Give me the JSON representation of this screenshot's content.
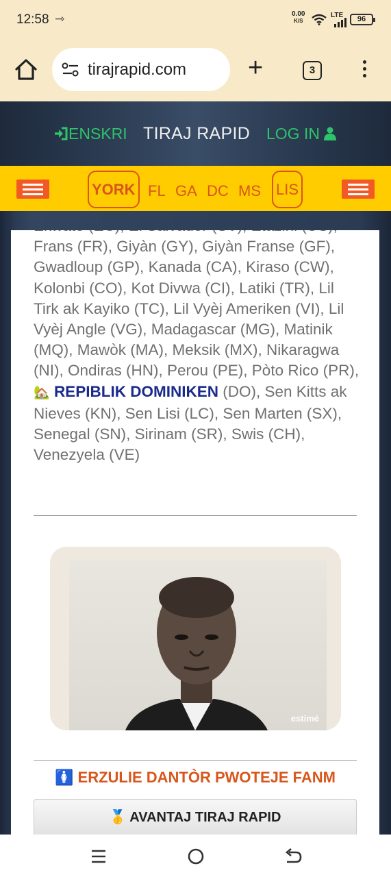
{
  "status": {
    "time": "12:58",
    "net_speed_value": "0.00",
    "net_speed_unit": "K/S",
    "lte": "LTE",
    "battery": "96"
  },
  "browser": {
    "url": "tirajrapid.com",
    "tab_count": "3"
  },
  "header": {
    "register_label": "ENSKRI",
    "title": "TIRAJ RAPID",
    "login_label": "LOG IN"
  },
  "nav": {
    "items": [
      "YORK",
      "FL",
      "GA",
      "DC",
      "MS",
      "LIS"
    ],
    "active": "YORK"
  },
  "countries": {
    "text_before": "Ekwatè (EC), El Salvador (SV), Etazini (US), Frans (FR), Giyàn (GY), Giyàn Franse (GF), Gwadloup (GP), Kanada (CA), Kiraso (CW), Kolonbi (CO), Kot Divwa (CI), Latiki (TR), Lil Tirk ak Kayiko (TC), Lil Vyèj Ameriken (VI), Lil Vyèj Angle (VG), Madagascar (MG), Matinik (MQ), Mawòk (MA), Meksik (MX), Nikaragwa (NI), Ondiras (HN), Perou (PE), Pòto Rico (PR),",
    "highlight": "REPIBLIK DOMINIKEN",
    "text_after": "(DO), Sen Kitts ak Nieves (KN), Sen Lisi (LC), Sen Marten (SX), Senegal (SN), Sirinam (SR), Swis (CH), Venezyela (VE)"
  },
  "photo": {
    "watermark": "estimé"
  },
  "banner": {
    "text": "ERZULIE DANTÒR PWOTEJE FANM"
  },
  "avantaj": {
    "label": "AVANTAJ TIRAJ RAPID"
  },
  "colors": {
    "nav_bg": "#ffcc00",
    "accent": "#d8561c",
    "link_green": "#2ec46b",
    "highlight_blue": "#1a2a8c"
  }
}
